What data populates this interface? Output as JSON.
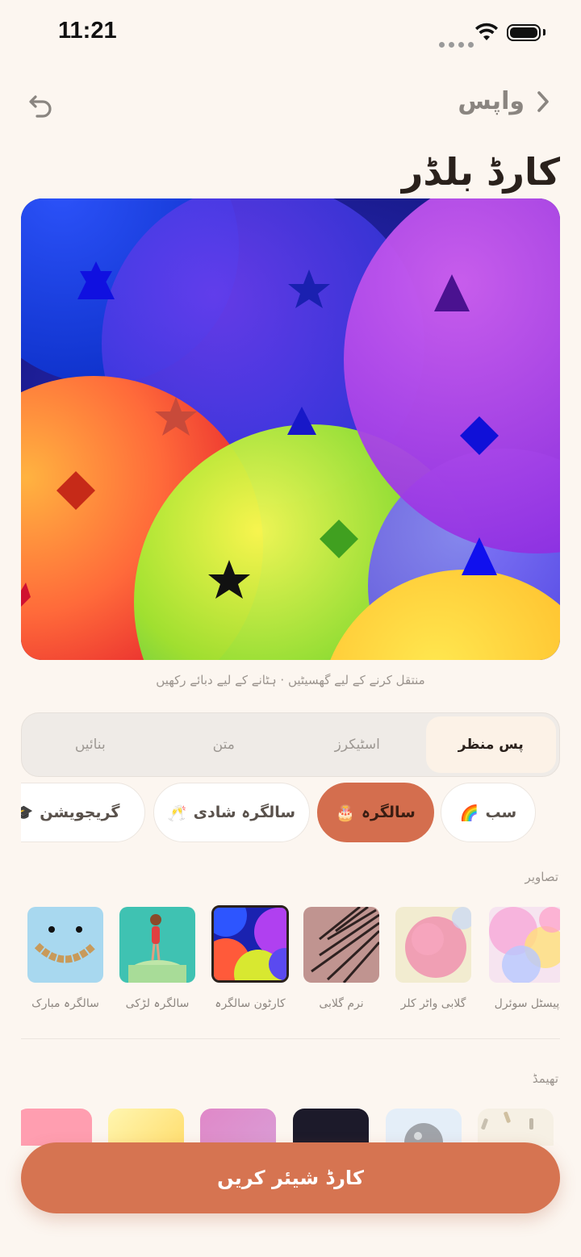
{
  "status": {
    "time": "11:21"
  },
  "nav": {
    "back_label": "واپس",
    "undo_icon": "undo-icon",
    "back_icon": "chevron-right-icon"
  },
  "header": {
    "title": "کارڈ بلڈر"
  },
  "canvas": {
    "hint": "منتقل کرنے کے لیے گھسیٹیں · ہٹانے کے لیے دبائے رکھیں"
  },
  "tabs": [
    {
      "label": "پس منظر",
      "active": true
    },
    {
      "label": "اسٹیکرز",
      "active": false
    },
    {
      "label": "متن",
      "active": false
    },
    {
      "label": "بنائیں",
      "active": false
    }
  ],
  "chips": [
    {
      "label": "سب",
      "emoji": "🌈",
      "active": false
    },
    {
      "label": "سالگرہ",
      "emoji": "🎂",
      "active": true
    },
    {
      "label": "سالگرہ شادی",
      "emoji": "🥂",
      "active": false
    },
    {
      "label": "گریجویشن",
      "emoji": "🎓",
      "active": false
    }
  ],
  "photos": {
    "label": "تصاویر",
    "items": [
      {
        "label": "پیسٹل سوئرل"
      },
      {
        "label": "گلابی واٹر کلر"
      },
      {
        "label": "نرم گلابی"
      },
      {
        "label": "کارٹون سالگرہ",
        "selected": true
      },
      {
        "label": "سالگرہ لڑکی"
      },
      {
        "label": "سالگرہ مبارک"
      }
    ]
  },
  "themes": {
    "label": "تھیمڈ"
  },
  "share": {
    "label": "کارڈ شیئر کریں"
  },
  "colors": {
    "accent": "#d67451",
    "background": "#fcf6f0",
    "chip_active": "#d46e4e"
  }
}
